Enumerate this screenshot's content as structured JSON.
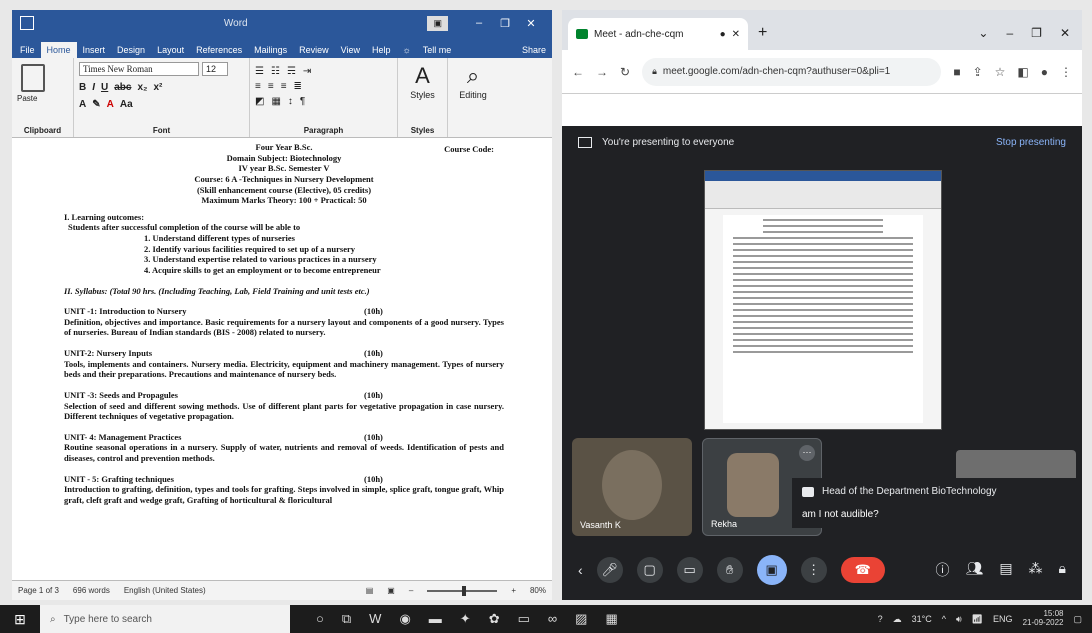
{
  "word": {
    "title": "Word",
    "tabs": [
      "File",
      "Home",
      "Insert",
      "Design",
      "Layout",
      "References",
      "Mailings",
      "Review",
      "View",
      "Help"
    ],
    "tell_me": "Tell me",
    "share": "Share",
    "ribbon": {
      "paste": "Paste",
      "clipboard": "Clipboard",
      "font_name": "Times New Roman",
      "font_size": "12",
      "font_group": "Font",
      "paragraph_group": "Paragraph",
      "styles": "Styles",
      "styles_group": "Styles",
      "editing": "Editing"
    },
    "doc": {
      "course_code": "Course Code:",
      "header_lines": [
        "Four Year B.Sc.",
        "Domain Subject: Biotechnology",
        "IV year B.Sc. Semester V",
        "Course: 6 A -Techniques in Nursery Development",
        "(Skill enhancement course (Elective), 05 credits)",
        "Maximum Marks Theory: 100 + Practical: 50"
      ],
      "learning_title": "I. Learning outcomes:",
      "learning_intro": "Students after successful completion of the course will be able to",
      "outcomes": [
        "1. Understand different types of nurseries",
        "2. Identify various facilities required to set up of a nursery",
        "3. Understand expertise related to various practices in a nursery",
        "4. Acquire skills to get an employment or to become entrepreneur"
      ],
      "syllabus_line": "II. Syllabus: (Total 90 hrs. (Including Teaching, Lab, Field Training and unit tests etc.)",
      "units": [
        {
          "title": "UNIT -1: Introduction to Nursery",
          "hrs": "(10h)",
          "body": "Definition, objectives and importance. Basic requirements for a nursery layout and components of a good nursery. Types of nurseries. Bureau of Indian standards (BIS - 2008) related to nursery."
        },
        {
          "title": "UNIT-2: Nursery Inputs",
          "hrs": "(10h)",
          "body": "Tools, implements and containers. Nursery media. Electricity, equipment and machinery management. Types of nursery beds and their preparations. Precautions and maintenance of nursery beds."
        },
        {
          "title": "UNIT -3: Seeds and Propagules",
          "hrs": "(10h)",
          "body": "Selection of seed and different sowing methods. Use of different plant parts for vegetative propagation in case nursery. Different techniques of vegetative propagation."
        },
        {
          "title": "UNIT- 4: Management Practices",
          "hrs": "(10h)",
          "body": "Routine seasonal operations in a nursery. Supply of water, nutrients and removal of weeds. Identification of pests and diseases, control and prevention methods."
        },
        {
          "title": "UNIT - 5: Grafting techniques",
          "hrs": "(10h)",
          "body": "Introduction to grafting, definition, types and tools for grafting. Steps involved in simple, splice graft, tongue graft, Whip graft, cleft graft and wedge graft, Grafting of horticultural & floricultural"
        }
      ]
    },
    "status": {
      "page": "Page 1 of 3",
      "words": "696 words",
      "language": "English (United States)",
      "zoom": "80%",
      "zoom_fraction": 0.5
    }
  },
  "chrome": {
    "tab_title": "Meet - adn-che-cqm",
    "url": "meet.google.com/adn-chen-cqm?authuser=0&pli=1",
    "presenting_text": "You're presenting to everyone",
    "stop_presenting": "Stop presenting",
    "participants": [
      "Vasanth K",
      "Rekha"
    ],
    "notification_sender": "Head of the Department BioTechnology",
    "notification_message": "am I not audible?"
  },
  "taskbar": {
    "search_placeholder": "Type here to search",
    "temperature": "31°C",
    "language": "ENG",
    "time": "15:08",
    "date": "21-09-2022"
  }
}
